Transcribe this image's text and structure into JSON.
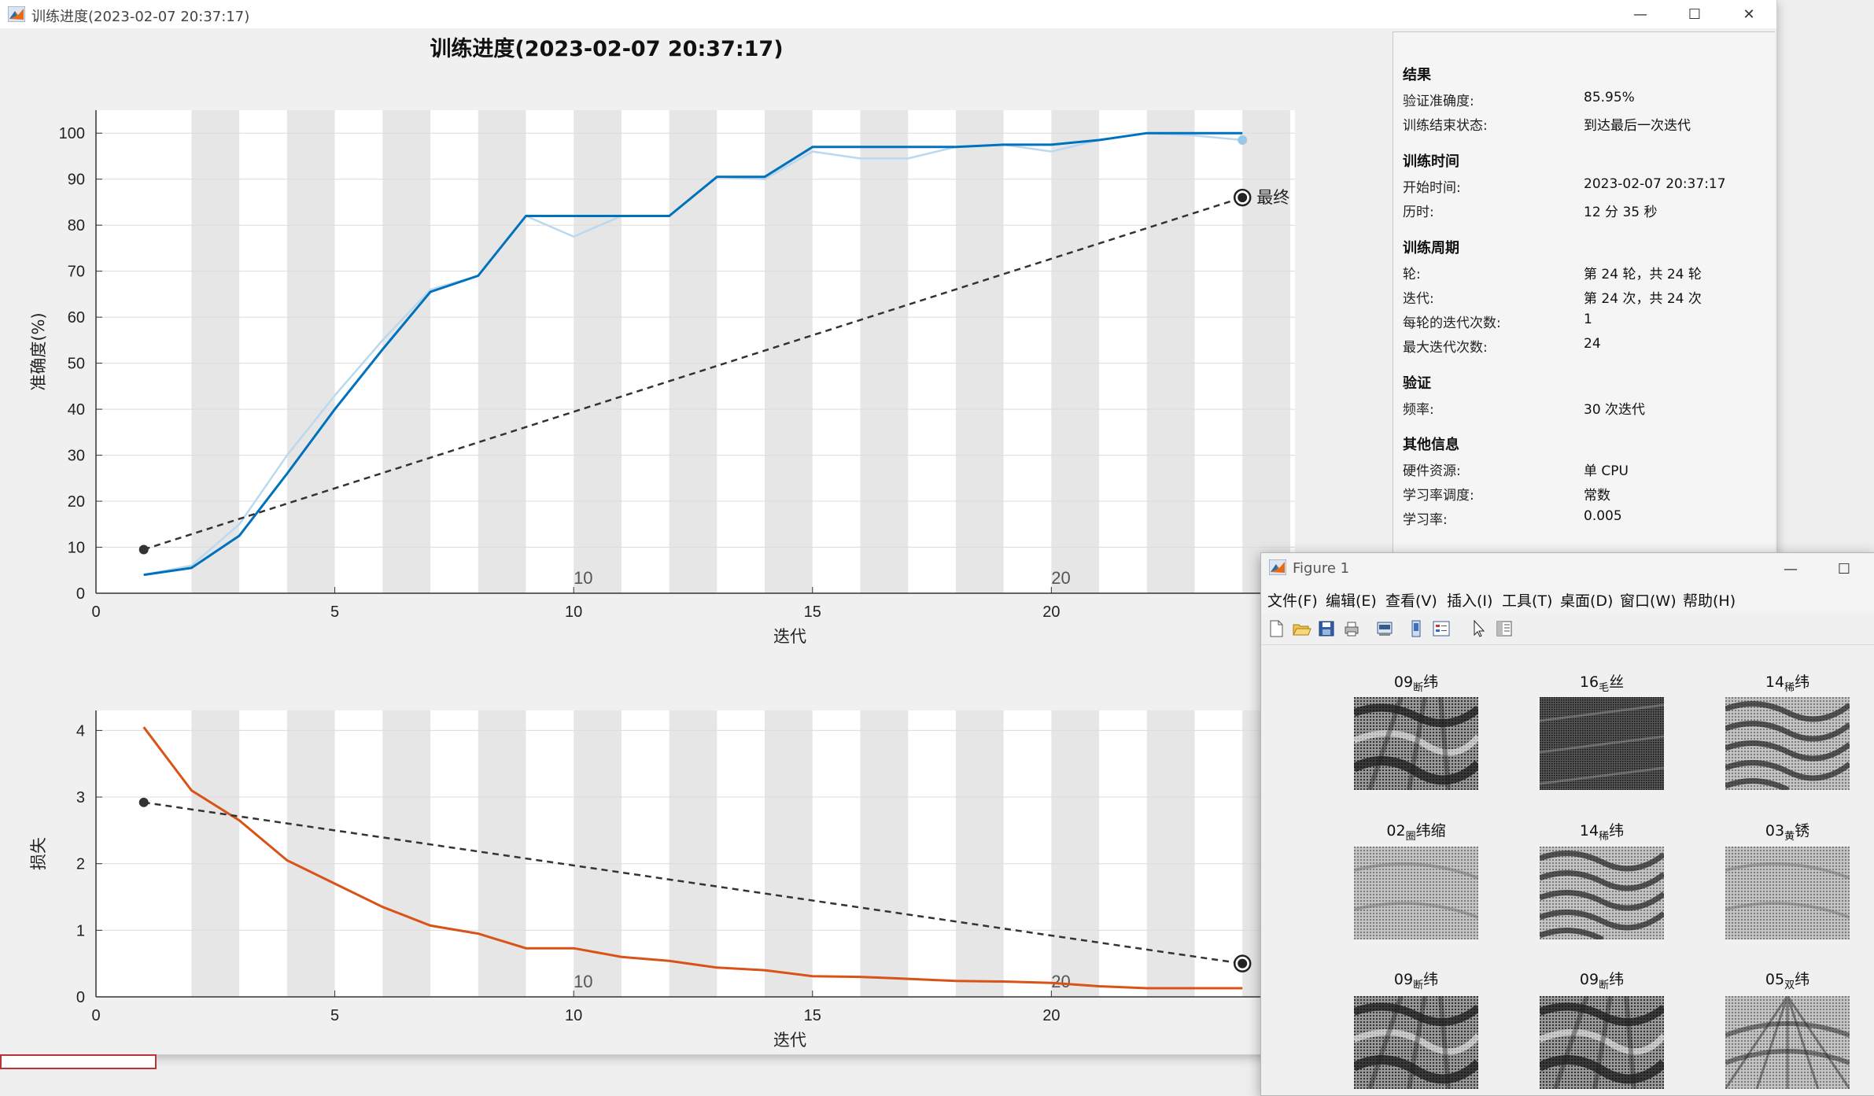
{
  "main_window": {
    "title": "训练进度(2023-02-07 20:37:17)",
    "controls": [
      "—",
      "☐",
      "✕"
    ]
  },
  "plot_title": "训练进度(2023-02-07 20:37:17)",
  "chart_data": [
    {
      "type": "line",
      "ylabel": "准确度(%)",
      "xlabel": "迭代",
      "xlim": [
        0,
        25.1
      ],
      "ylim": [
        0,
        105
      ],
      "xticks": [
        0,
        5,
        10,
        15,
        20
      ],
      "yticks": [
        0,
        10,
        20,
        30,
        40,
        50,
        60,
        70,
        80,
        90,
        100
      ],
      "epoch_labels": [
        {
          "label": "10",
          "x": 10.2
        },
        {
          "label": "20",
          "x": 20.2
        }
      ],
      "grid": true,
      "epoch_stripe_every": 1,
      "series": [
        {
          "name": "",
          "color": "#bcd8ee",
          "x": [
            1,
            2,
            3,
            4,
            5,
            6,
            7,
            8,
            9,
            10,
            11,
            12,
            13,
            14,
            15,
            16,
            17,
            18,
            19,
            20,
            21,
            22,
            23,
            24
          ],
          "values": [
            4,
            6,
            15,
            30,
            43,
            55,
            66,
            69,
            82,
            77.5,
            82,
            82,
            90.5,
            90,
            96,
            94.5,
            94.5,
            97,
            97.5,
            96,
            98.5,
            100,
            99.5,
            98.5
          ]
        },
        {
          "name": "",
          "color": "#0072bd",
          "x": [
            1,
            2,
            3,
            4,
            5,
            6,
            7,
            8,
            9,
            10,
            11,
            12,
            13,
            14,
            15,
            16,
            17,
            18,
            19,
            20,
            21,
            22,
            23,
            24
          ],
          "values": [
            4,
            5.5,
            12.5,
            26,
            40,
            53,
            65.5,
            69,
            82,
            82,
            82,
            82,
            90.5,
            90.5,
            97,
            97,
            97,
            97,
            97.5,
            97.5,
            98.5,
            100,
            100,
            100
          ]
        },
        {
          "name": "",
          "color": "#333333",
          "dashed": true,
          "x": [
            1,
            24
          ],
          "values": [
            9.5,
            86
          ]
        }
      ],
      "final_point": {
        "x": 24,
        "y": 86,
        "label": "最终"
      },
      "last_marker": {
        "x": 24,
        "y": 98.5
      }
    },
    {
      "type": "line",
      "ylabel": "损失",
      "xlabel": "迭代",
      "xlim": [
        0,
        25.1
      ],
      "ylim": [
        0,
        4.3
      ],
      "xticks": [
        0,
        5,
        10,
        15,
        20
      ],
      "yticks": [
        0,
        1,
        2,
        3,
        4
      ],
      "epoch_labels": [
        {
          "label": "10",
          "x": 10.2
        },
        {
          "label": "20",
          "x": 20.2
        }
      ],
      "grid": true,
      "series": [
        {
          "name": "",
          "color": "#d95319",
          "x": [
            1,
            2,
            3,
            4,
            5,
            6,
            7,
            8,
            9,
            10,
            11,
            12,
            13,
            14,
            15,
            16,
            17,
            18,
            19,
            20,
            21,
            22,
            23,
            24
          ],
          "values": [
            4.05,
            3.1,
            2.65,
            2.05,
            1.7,
            1.35,
            1.07,
            0.95,
            0.73,
            0.73,
            0.6,
            0.54,
            0.44,
            0.4,
            0.31,
            0.3,
            0.27,
            0.24,
            0.23,
            0.21,
            0.16,
            0.13,
            0.13,
            0.13
          ]
        },
        {
          "name": "",
          "color": "#333333",
          "dashed": true,
          "x": [
            1,
            24
          ],
          "values": [
            2.92,
            0.5
          ]
        }
      ],
      "final_point": {
        "x": 24,
        "y": 0.5,
        "label": ""
      }
    }
  ],
  "results": {
    "sections": [
      {
        "heading": "结果",
        "rows": [
          {
            "k": "验证准确度:",
            "v": "85.95%"
          },
          {
            "k": "训练结束状态:",
            "v": "到达最后一次迭代"
          }
        ]
      },
      {
        "heading": "训练时间",
        "rows": [
          {
            "k": "开始时间:",
            "v": "2023-02-07 20:37:17"
          },
          {
            "k": "历时:",
            "v": "12 分 35 秒"
          }
        ]
      },
      {
        "heading": "训练周期",
        "rows": [
          {
            "k": "轮:",
            "v": "第 24 轮，共 24 轮"
          },
          {
            "k": "迭代:",
            "v": "第 24 次，共 24 次"
          },
          {
            "k": "每轮的迭代次数:",
            "v": "1"
          },
          {
            "k": "最大迭代次数:",
            "v": "24"
          }
        ]
      },
      {
        "heading": "验证",
        "rows": [
          {
            "k": "频率:",
            "v": "30 次迭代"
          }
        ]
      },
      {
        "heading": "其他信息",
        "rows": [
          {
            "k": "硬件资源:",
            "v": "单 CPU"
          },
          {
            "k": "学习率调度:",
            "v": "常数"
          },
          {
            "k": "学习率:",
            "v": "0.005"
          }
        ]
      }
    ]
  },
  "figure_window": {
    "title": "Figure 1",
    "controls": [
      "—",
      "☐"
    ],
    "menu": [
      "文件(F)",
      "编辑(E)",
      "查看(V)",
      "插入(I)",
      "工具(T)",
      "桌面(D)",
      "窗口(W)",
      "帮助(H)"
    ],
    "toolbar_icons": [
      "new-file-icon",
      "open-folder-icon",
      "save-icon",
      "print-icon",
      "print-preview-icon",
      "link-plot-icon",
      "insert-legend-icon",
      "pointer-icon",
      "property-inspector-icon"
    ],
    "thumbnails": [
      {
        "main": "09",
        "sub": "断",
        "suffix": "纬",
        "pattern": "bands"
      },
      {
        "main": "16",
        "sub": "毛",
        "suffix": "丝",
        "pattern": "fine"
      },
      {
        "main": "14",
        "sub": "稀",
        "suffix": "纬",
        "pattern": "waves"
      },
      {
        "main": "02",
        "sub": "圈",
        "suffix": "纬缩",
        "pattern": "light"
      },
      {
        "main": "14",
        "sub": "稀",
        "suffix": "纬",
        "pattern": "waves"
      },
      {
        "main": "03",
        "sub": "黄",
        "suffix": "锈",
        "pattern": "light"
      },
      {
        "main": "09",
        "sub": "断",
        "suffix": "纬",
        "pattern": "bands"
      },
      {
        "main": "09",
        "sub": "断",
        "suffix": "纬",
        "pattern": "bands"
      },
      {
        "main": "05",
        "sub": "双",
        "suffix": "纬",
        "pattern": "fan"
      }
    ]
  }
}
